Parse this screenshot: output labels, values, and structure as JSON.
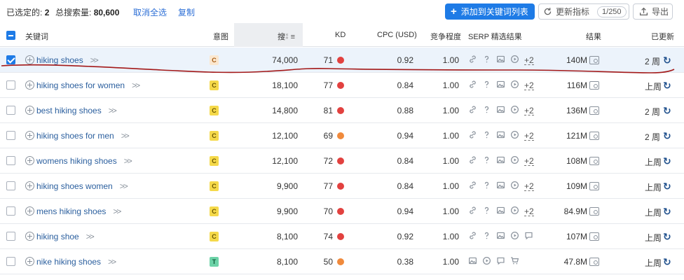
{
  "toolbar": {
    "selected_label": "已选定的:",
    "selected_count": "2",
    "total_volume_label": "总搜索量:",
    "total_volume": "80,600",
    "deselect_all": "取消全选",
    "copy": "复制",
    "add_to_list": "添加到关键词列表",
    "refresh_metrics": "更新指标",
    "refresh_count": "1/250",
    "export": "导出"
  },
  "header": {
    "keyword": "关键词",
    "intent": "意图",
    "volume": "搜",
    "kd": "KD",
    "cpc": "CPC (USD)",
    "competition": "竞争程度",
    "serp_features": "SERP 精选结果",
    "results": "结果",
    "updated": "已更新"
  },
  "colors": {
    "intent_c_bg": "#f5d94a",
    "intent_c_selected_bg": "#fbe7cf",
    "intent_t_bg": "#6dd3a8",
    "kd_red": "#e2413f",
    "kd_orange": "#f08a3c",
    "accent": "#1e7be6",
    "scribble": "#a31818"
  },
  "serp_icon_set_a": [
    "link-icon",
    "question-icon",
    "image-icon",
    "video-icon"
  ],
  "serp_icon_set_b": [
    "link-icon",
    "question-icon",
    "image-icon",
    "video-icon",
    "review-icon"
  ],
  "serp_icon_set_c": [
    "image-icon",
    "video-icon",
    "review-icon",
    "cart-icon"
  ],
  "rows": [
    {
      "keyword": "hiking shoes",
      "intent": "C",
      "volume": "74,000",
      "kd": "71",
      "kd_color": "red",
      "cpc": "0.92",
      "competition": "1.00",
      "serp_more": "+2",
      "results": "140M",
      "updated": "2 周",
      "selected": true
    },
    {
      "keyword": "hiking shoes for women",
      "intent": "C",
      "volume": "18,100",
      "kd": "77",
      "kd_color": "red",
      "cpc": "0.84",
      "competition": "1.00",
      "serp_more": "+2",
      "results": "116M",
      "updated": "上周",
      "selected": false
    },
    {
      "keyword": "best hiking shoes",
      "intent": "C",
      "volume": "14,800",
      "kd": "81",
      "kd_color": "red",
      "cpc": "0.88",
      "competition": "1.00",
      "serp_more": "+2",
      "results": "136M",
      "updated": "2 周",
      "selected": false
    },
    {
      "keyword": "hiking shoes for men",
      "intent": "C",
      "volume": "12,100",
      "kd": "69",
      "kd_color": "orange",
      "cpc": "0.94",
      "competition": "1.00",
      "serp_more": "+2",
      "results": "121M",
      "updated": "2 周",
      "selected": false
    },
    {
      "keyword": "womens hiking shoes",
      "intent": "C",
      "volume": "12,100",
      "kd": "72",
      "kd_color": "red",
      "cpc": "0.84",
      "competition": "1.00",
      "serp_more": "+2",
      "results": "108M",
      "updated": "上周",
      "selected": false
    },
    {
      "keyword": "hiking shoes women",
      "intent": "C",
      "volume": "9,900",
      "kd": "77",
      "kd_color": "red",
      "cpc": "0.84",
      "competition": "1.00",
      "serp_more": "+2",
      "results": "109M",
      "updated": "上周",
      "selected": false
    },
    {
      "keyword": "mens hiking shoes",
      "intent": "C",
      "volume": "9,900",
      "kd": "70",
      "kd_color": "red",
      "cpc": "0.94",
      "competition": "1.00",
      "serp_more": "+2",
      "results": "84.9M",
      "updated": "上周",
      "selected": false
    },
    {
      "keyword": "hiking shoe",
      "intent": "C",
      "volume": "8,100",
      "kd": "74",
      "kd_color": "red",
      "cpc": "0.92",
      "competition": "1.00",
      "serp_more": "",
      "results": "107M",
      "updated": "上周",
      "selected": false
    },
    {
      "keyword": "nike hiking shoes",
      "intent": "T",
      "volume": "8,100",
      "kd": "50",
      "kd_color": "orange",
      "cpc": "0.38",
      "competition": "1.00",
      "serp_more": "",
      "results": "47.8M",
      "updated": "上周",
      "selected": false
    }
  ]
}
